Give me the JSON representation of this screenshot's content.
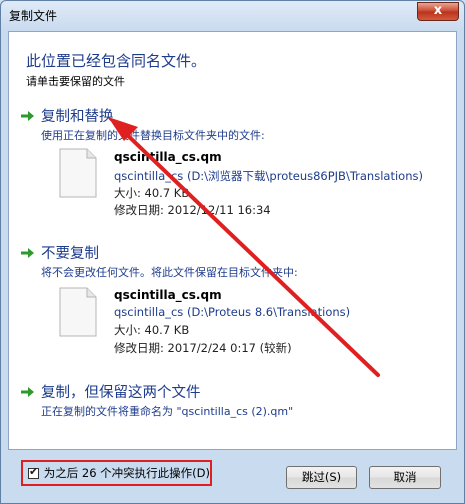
{
  "window": {
    "title": "复制文件",
    "close_label": "x"
  },
  "header": {
    "heading": "此位置已经包含同名文件。",
    "subheading": "请单击要保留的文件"
  },
  "options": {
    "replace": {
      "title": "复制和替换",
      "description": "使用正在复制的文件替换目标文件夹中的文件:",
      "file_name": "qscintilla_cs.qm",
      "file_path": "qscintilla_cs (D:\\浏览器下载\\proteus86PJB\\Translations)",
      "size": "大小: 40.7 KB",
      "modified": "修改日期: 2012/12/11 16:34"
    },
    "skip": {
      "title": "不要复制",
      "description": "将不会更改任何文件。将此文件保留在目标文件夹中:",
      "file_name": "qscintilla_cs.qm",
      "file_path": "qscintilla_cs (D:\\Proteus 8.6\\Translations)",
      "size": "大小: 40.7 KB",
      "modified": "修改日期: 2017/2/24 0:17 (较新)"
    },
    "keep_both": {
      "title": "复制，但保留这两个文件",
      "description": "正在复制的文件将重命名为 \"qscintilla_cs (2).qm\""
    }
  },
  "footer": {
    "checkbox_label": "为之后 26 个冲突执行此操作(D)",
    "checkbox_checked": true,
    "skip_button": "跳过(S)",
    "cancel_button": "取消"
  },
  "icons": {
    "arrow": "green-arrow-icon",
    "file": "file-icon",
    "annotation": "red-arrow-annotation"
  },
  "colors": {
    "link_blue": "#1e3c8c",
    "arrow_green": "#2e9a2e",
    "annotation_red": "#e02020"
  }
}
